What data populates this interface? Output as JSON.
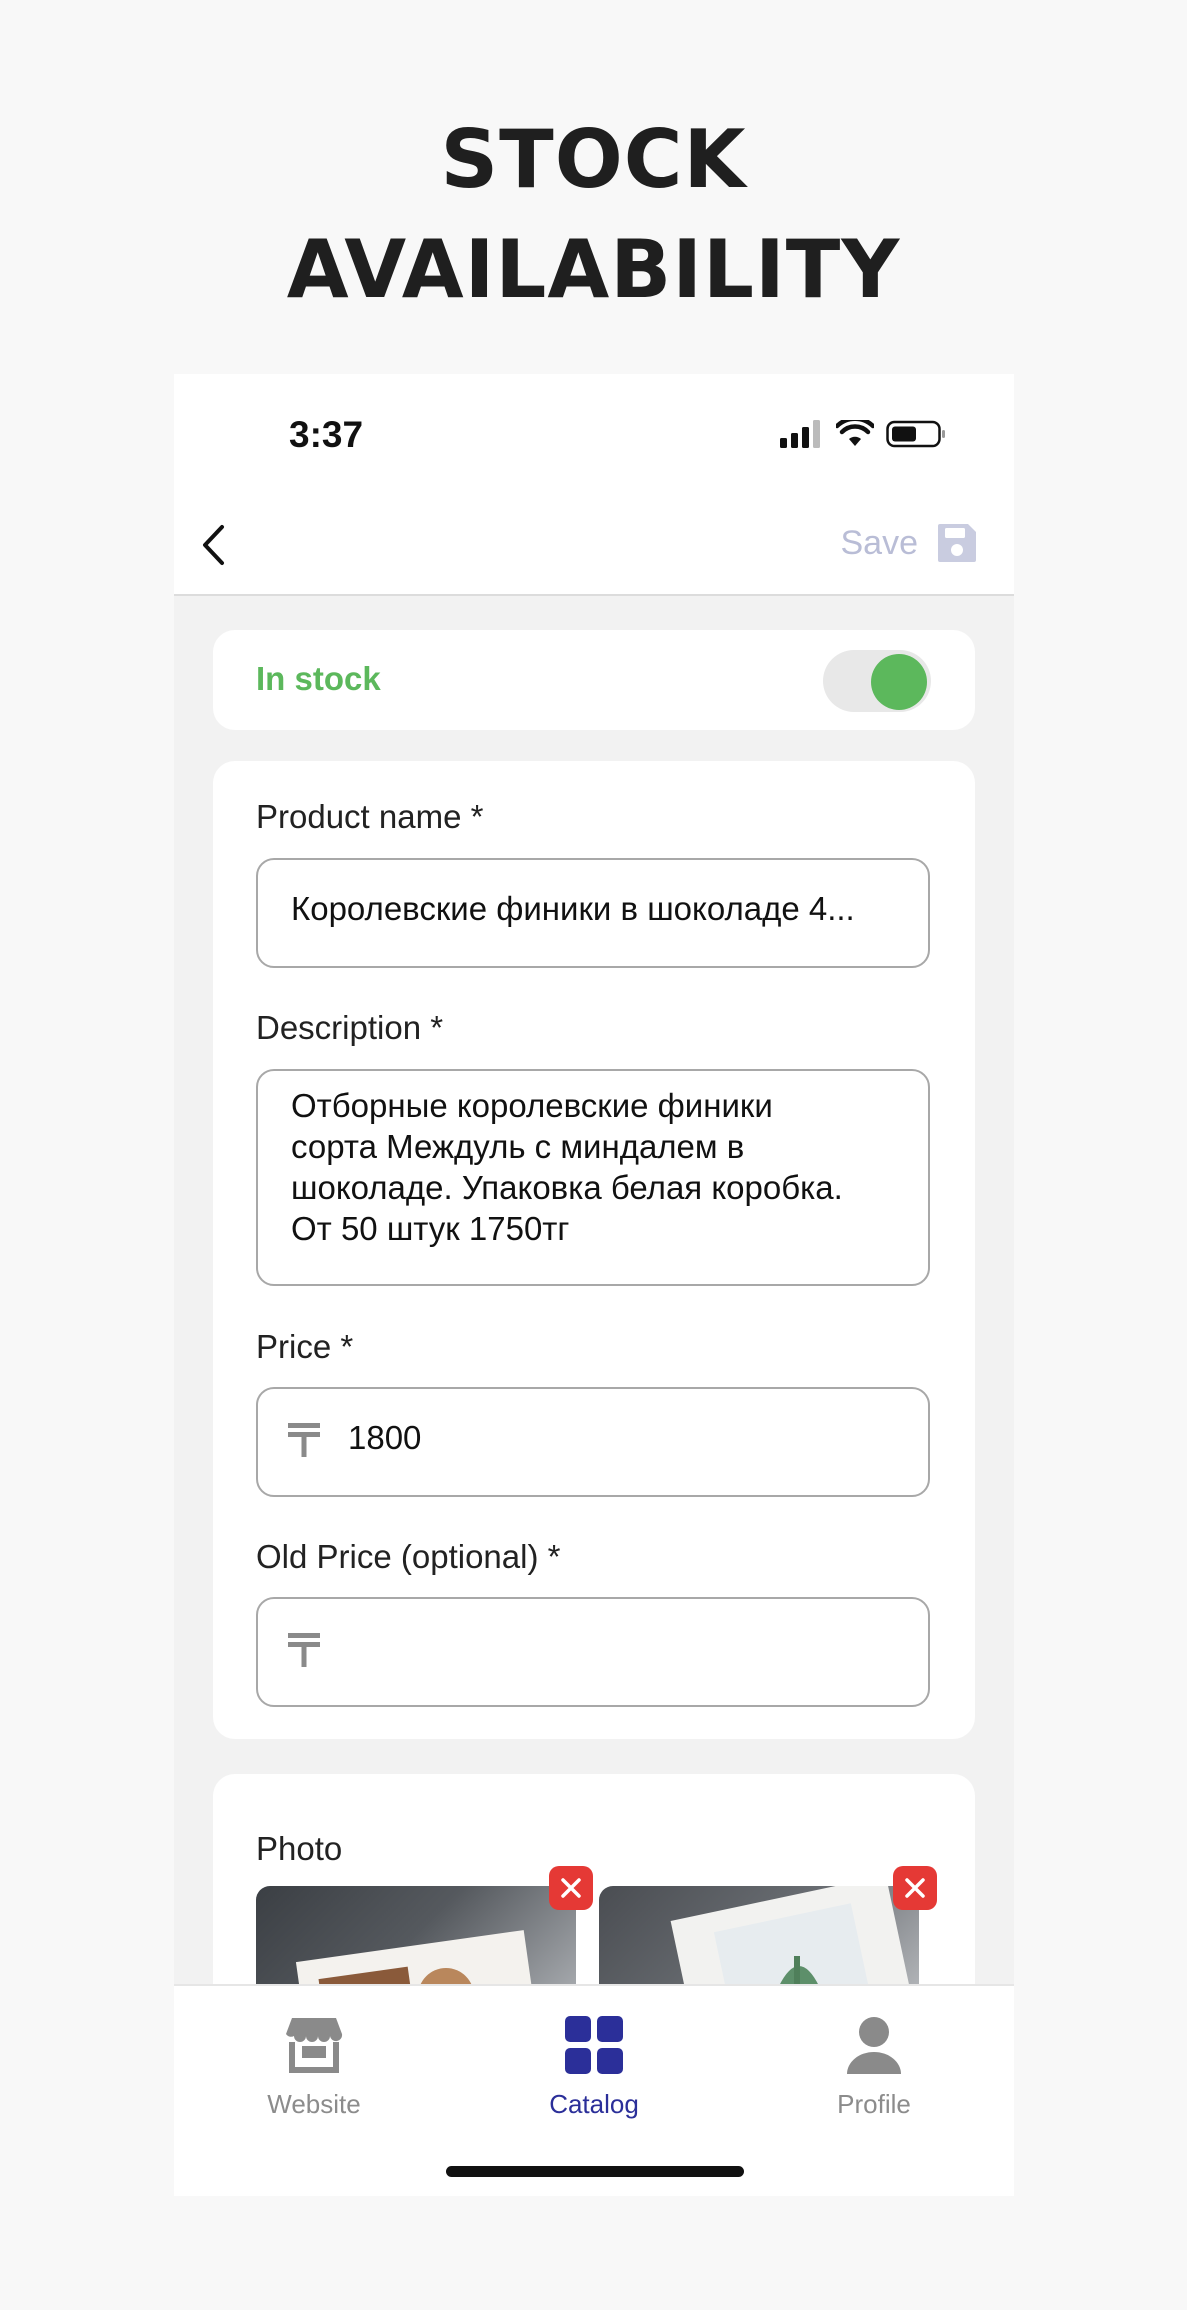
{
  "headline": {
    "line1": "STOCK",
    "line2": "AVAILABILITY"
  },
  "status_bar": {
    "time": "3:37",
    "icons": [
      "cellular-signal-icon",
      "wifi-icon",
      "battery-icon"
    ]
  },
  "nav": {
    "back_icon": "chevron-left-icon",
    "save_label": "Save",
    "save_icon": "floppy-disk-icon"
  },
  "stock": {
    "label": "In stock",
    "enabled": true
  },
  "form": {
    "product_name": {
      "label": "Product name *",
      "value": "Королевские финики в шоколаде 4..."
    },
    "description": {
      "label": "Description *",
      "lines": [
        "Отборные королевские финики",
        "сорта Междуль с миндалем в",
        "шоколаде. Упаковка белая коробка.",
        "От 50 штук 1750тг"
      ]
    },
    "price": {
      "label": "Price *",
      "value": "1800",
      "currency_icon": "tenge-icon"
    },
    "old_price": {
      "label": "Old Price (optional) *",
      "value": "",
      "currency_icon": "tenge-icon"
    }
  },
  "photos": {
    "label": "Photo",
    "items": [
      {
        "remove_icon": "close-icon"
      },
      {
        "remove_icon": "close-icon"
      }
    ]
  },
  "tabbar": {
    "tabs": [
      {
        "label": "Website",
        "icon": "storefront-icon",
        "active": false
      },
      {
        "label": "Catalog",
        "icon": "grid-icon",
        "active": true
      },
      {
        "label": "Profile",
        "icon": "person-icon",
        "active": false
      }
    ]
  },
  "colors": {
    "accent": "#2b2f99",
    "in_stock": "#5cb85c",
    "delete": "#e53935",
    "save_disabled": "#b9bdd6"
  }
}
